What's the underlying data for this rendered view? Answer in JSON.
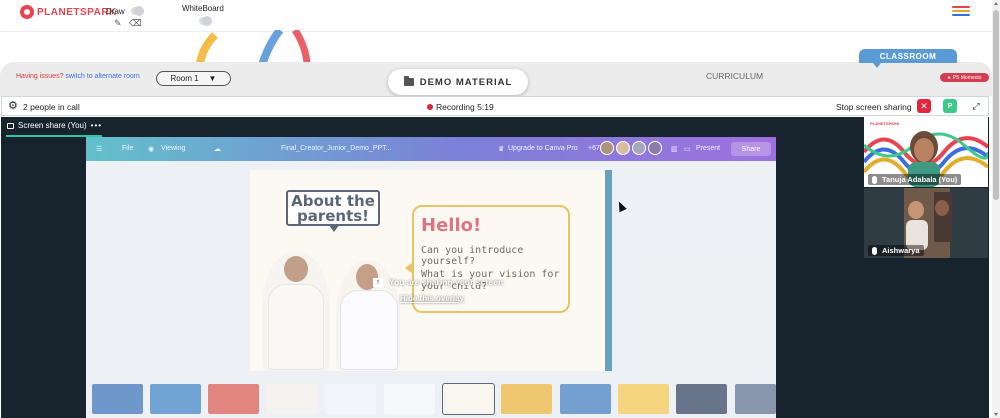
{
  "header": {
    "logo_text": "PLANETSPARK",
    "draw_label": "Draw",
    "whiteboard_label": "WhiteBoard",
    "brand_color": "#e8434f",
    "menu_colors": [
      "#e8434f",
      "#e1ad2b",
      "#3b6ee0"
    ]
  },
  "roombar": {
    "issues_text": "Having issues?",
    "alternate_link": "switch to alternate room",
    "room_selected": "Room 1",
    "demo_material": "DEMO MATERIAL",
    "curriculum": "CURRICULUM",
    "classroom_tab": "CLASSROOM",
    "moments_badge": "PS Moments"
  },
  "callbar": {
    "people_count": "2 people in call",
    "recording_label": "Recording",
    "recording_time": "5:19",
    "stop_share": "Stop screen sharing",
    "p_button": "P"
  },
  "stage": {
    "share_tab": "Screen share (You)",
    "overlay_message": "You are sharing your screen",
    "hide_overlay": "Hide this overlay"
  },
  "shared_screen": {
    "canva_menu": [
      "File",
      "Viewing",
      "Final_Creator_Junior_Demo_PPT..."
    ],
    "upgrade": "Upgrade to Canva Pro",
    "collab_count": "+67",
    "present": "Present",
    "share": "Share",
    "slide": {
      "about_title": "About the parents!",
      "hello": "Hello!",
      "question_1": "Can you introduce yourself?",
      "question_2": "What is your vision for your child?"
    }
  },
  "videos": [
    {
      "name": "Tanuja Adabala (You)"
    },
    {
      "name": "Aishwarya"
    }
  ]
}
